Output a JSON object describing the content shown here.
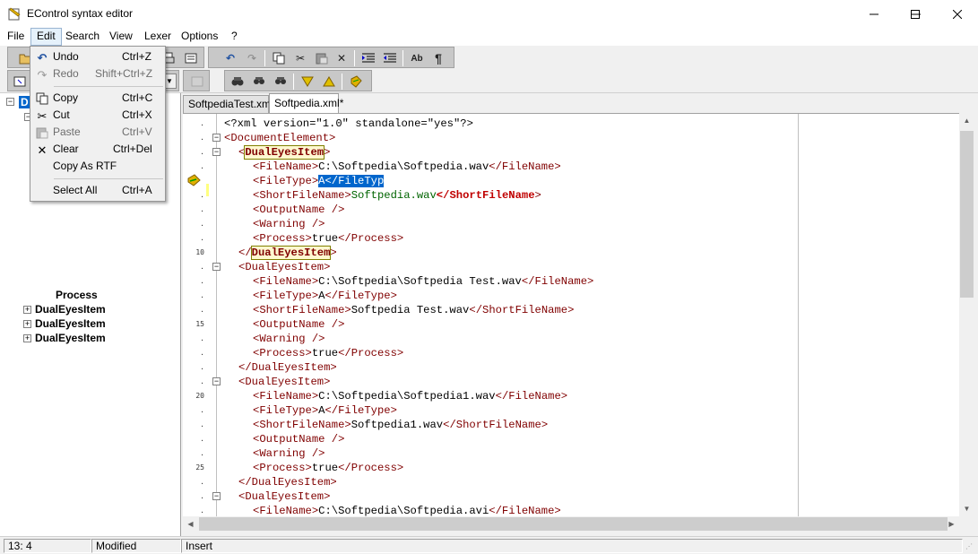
{
  "window": {
    "title": "EControl syntax editor"
  },
  "menubar": {
    "items": [
      {
        "label": "File"
      },
      {
        "label": "Edit"
      },
      {
        "label": "Search"
      },
      {
        "label": "View"
      },
      {
        "label": "Lexer"
      },
      {
        "label": "Options"
      },
      {
        "label": "?"
      }
    ]
  },
  "edit_menu": {
    "undo": {
      "label": "Undo",
      "shortcut": "Ctrl+Z"
    },
    "redo": {
      "label": "Redo",
      "shortcut": "Shift+Ctrl+Z"
    },
    "copy": {
      "label": "Copy",
      "shortcut": "Ctrl+C"
    },
    "cut": {
      "label": "Cut",
      "shortcut": "Ctrl+X"
    },
    "paste": {
      "label": "Paste",
      "shortcut": "Ctrl+V"
    },
    "clear": {
      "label": "Clear",
      "shortcut": "Ctrl+Del"
    },
    "copy_rtf": {
      "label": "Copy As RTF"
    },
    "select_all": {
      "label": "Select All",
      "shortcut": "Ctrl+A"
    }
  },
  "tabs": [
    {
      "label": "SoftpediaTest.xml"
    },
    {
      "label": "Softpedia.xml*"
    }
  ],
  "tree": {
    "root": "D",
    "items": [
      "Process",
      "DualEyesItem",
      "DualEyesItem",
      "DualEyesItem"
    ]
  },
  "editor": {
    "line_numbers": [
      "10",
      "15",
      "20",
      "25"
    ],
    "tags": {
      "xmldecl": "<?xml version=\"1.0\" standalone=\"yes\"?>",
      "doc_open": "<DocumentElement>",
      "item": "DualEyesItem",
      "item_open": "<DualEyesItem>",
      "item_close": "</DualEyesItem>",
      "filename_open": "<FileName>",
      "filename_close": "</FileName>",
      "filetype_open": "<FileType>",
      "filetype_close": "</FileType>",
      "filetyp_close_sel": "</FileTyp",
      "shortname_open": "<ShortFileName>",
      "shortname_close": "</ShortFileName>",
      "shortname_tag": "ShortFileName",
      "output": "<OutputName />",
      "warning": "<Warning />",
      "process_open": "<Process>",
      "process_close": "</Process>",
      "lt": "<",
      "gt": ">",
      "lt_slash": "</"
    },
    "values": {
      "file1": "C:\\Softpedia\\Softpedia.wav",
      "type": "A",
      "short1": "Softpedia.wav",
      "true": "true",
      "file2": "C:\\Softpedia\\Softpedia Test.wav",
      "short2": "Softpedia Test.wav",
      "file3": "C:\\Softpedia\\Softpedia1.wav",
      "short3": "Softpedia1.wav",
      "file4": "C:\\Softpedia\\Softpedia.avi",
      "dot": "."
    }
  },
  "status": {
    "position": "13: 4",
    "modified": "Modified",
    "mode": "Insert"
  },
  "colors": {
    "tag": "#800000",
    "selection": "#0066cc",
    "string_green": "#006400"
  }
}
